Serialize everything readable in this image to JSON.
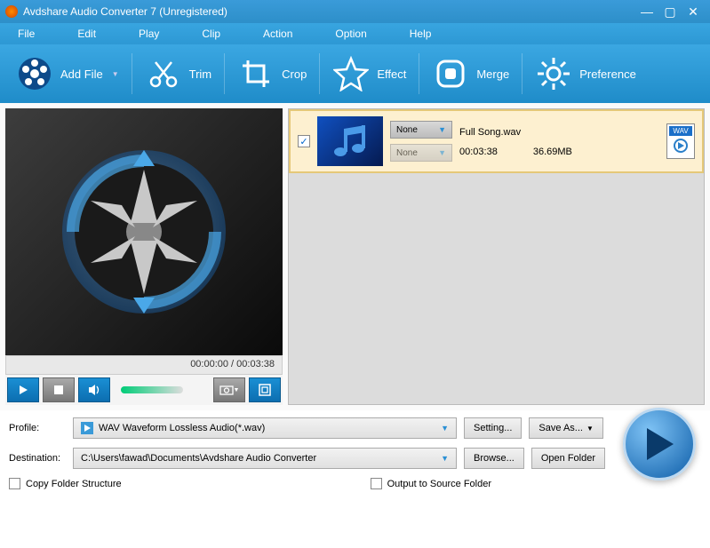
{
  "title": "Avdshare Audio Converter 7 (Unregistered)",
  "menu": [
    "File",
    "Edit",
    "Play",
    "Clip",
    "Action",
    "Option",
    "Help"
  ],
  "toolbar": {
    "add_file": "Add File",
    "trim": "Trim",
    "crop": "Crop",
    "effect": "Effect",
    "merge": "Merge",
    "preference": "Preference"
  },
  "preview": {
    "time": "00:00:00 / 00:03:38"
  },
  "file": {
    "name": "Full Song.wav",
    "duration": "00:03:38",
    "size": "36.69MB",
    "format": "WAV",
    "sel1": "None",
    "sel2": "None"
  },
  "profile": {
    "label": "Profile:",
    "value": "WAV Waveform Lossless Audio(*.wav)",
    "setting": "Setting...",
    "saveas": "Save As..."
  },
  "destination": {
    "label": "Destination:",
    "value": "C:\\Users\\fawad\\Documents\\Avdshare Audio Converter",
    "browse": "Browse...",
    "open": "Open Folder"
  },
  "checks": {
    "copy": "Copy Folder Structure",
    "output": "Output to Source Folder"
  }
}
